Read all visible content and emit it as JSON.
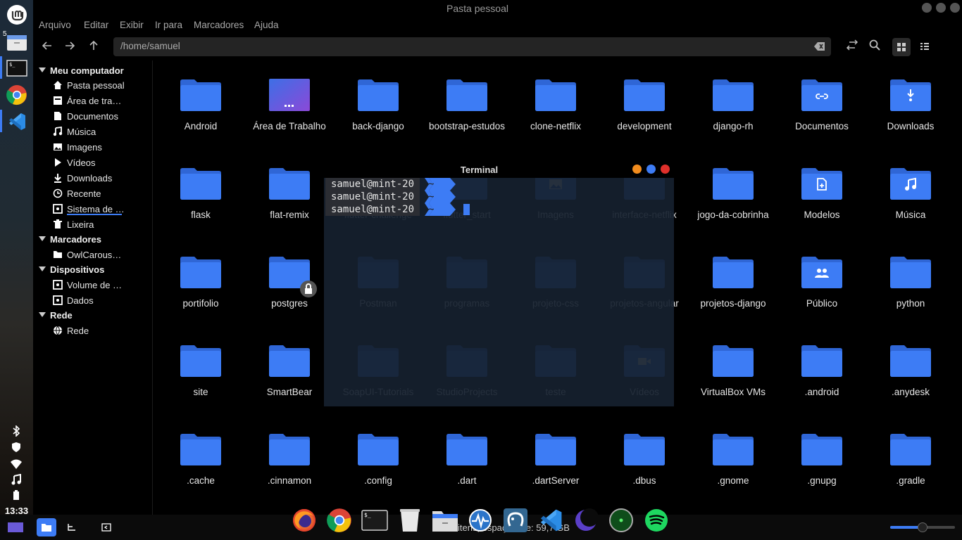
{
  "window": {
    "title": "Pasta pessoal"
  },
  "menu": [
    "Arquivo",
    "Editar",
    "Exibir",
    "Ir para",
    "Marcadores",
    "Ajuda"
  ],
  "location": {
    "path": "/home/samuel"
  },
  "sidebar": {
    "sections": [
      {
        "title": "Meu computador",
        "items": [
          {
            "label": "Pasta pessoal",
            "icon": "home-icon"
          },
          {
            "label": "Área de tra…",
            "icon": "desktop-icon"
          },
          {
            "label": "Documentos",
            "icon": "document-icon"
          },
          {
            "label": "Música",
            "icon": "music-icon"
          },
          {
            "label": "Imagens",
            "icon": "image-icon"
          },
          {
            "label": "Vídeos",
            "icon": "video-icon"
          },
          {
            "label": "Downloads",
            "icon": "download-icon"
          },
          {
            "label": "Recente",
            "icon": "clock-icon"
          },
          {
            "label": "Sistema de …",
            "icon": "drive-icon"
          },
          {
            "label": "Lixeira",
            "icon": "trash-icon"
          }
        ]
      },
      {
        "title": "Marcadores",
        "items": [
          {
            "label": "OwlCarous…",
            "icon": "folder-icon"
          }
        ]
      },
      {
        "title": "Dispositivos",
        "items": [
          {
            "label": "Volume de …",
            "icon": "drive-icon"
          },
          {
            "label": "Dados",
            "icon": "drive-icon"
          }
        ]
      },
      {
        "title": "Rede",
        "items": [
          {
            "label": "Rede",
            "icon": "network-icon"
          }
        ]
      }
    ]
  },
  "files": [
    {
      "name": "Android",
      "emblem": ""
    },
    {
      "name": "Área de Trabalho",
      "emblem": "desktop"
    },
    {
      "name": "back-django",
      "emblem": ""
    },
    {
      "name": "bootstrap-estudos",
      "emblem": ""
    },
    {
      "name": "clone-netflix",
      "emblem": ""
    },
    {
      "name": "development",
      "emblem": ""
    },
    {
      "name": "django-rh",
      "emblem": ""
    },
    {
      "name": "Documentos",
      "emblem": "link"
    },
    {
      "name": "Downloads",
      "emblem": "download"
    },
    {
      "name": "flask",
      "emblem": ""
    },
    {
      "name": "flat-remix",
      "emblem": ""
    },
    {
      "name": "flutter-challenge",
      "emblem": ""
    },
    {
      "name": "flutter_start",
      "emblem": ""
    },
    {
      "name": "Imagens",
      "emblem": "image"
    },
    {
      "name": "interface-netflix",
      "emblem": ""
    },
    {
      "name": "jogo-da-cobrinha",
      "emblem": ""
    },
    {
      "name": "Modelos",
      "emblem": "template"
    },
    {
      "name": "Música",
      "emblem": "music"
    },
    {
      "name": "portifolio",
      "emblem": ""
    },
    {
      "name": "postgres",
      "emblem": "lock"
    },
    {
      "name": "Postman",
      "emblem": ""
    },
    {
      "name": "programas",
      "emblem": ""
    },
    {
      "name": "projeto-css",
      "emblem": ""
    },
    {
      "name": "projetos-angular",
      "emblem": ""
    },
    {
      "name": "projetos-django",
      "emblem": ""
    },
    {
      "name": "Público",
      "emblem": "people"
    },
    {
      "name": "python",
      "emblem": ""
    },
    {
      "name": "site",
      "emblem": ""
    },
    {
      "name": "SmartBear",
      "emblem": ""
    },
    {
      "name": "SoapUI-Tutorials",
      "emblem": ""
    },
    {
      "name": "StudioProjects",
      "emblem": ""
    },
    {
      "name": "teste",
      "emblem": ""
    },
    {
      "name": "Vídeos",
      "emblem": "video"
    },
    {
      "name": "VirtualBox VMs",
      "emblem": ""
    },
    {
      "name": ".android",
      "emblem": ""
    },
    {
      "name": ".anydesk",
      "emblem": ""
    },
    {
      "name": ".cache",
      "emblem": ""
    },
    {
      "name": ".cinnamon",
      "emblem": ""
    },
    {
      "name": ".config",
      "emblem": ""
    },
    {
      "name": ".dart",
      "emblem": ""
    },
    {
      "name": ".dartServer",
      "emblem": ""
    },
    {
      "name": ".dbus",
      "emblem": ""
    },
    {
      "name": ".gnome",
      "emblem": ""
    },
    {
      "name": ".gnupg",
      "emblem": ""
    },
    {
      "name": ".gradle",
      "emblem": ""
    }
  ],
  "terminal": {
    "title": "Terminal",
    "lines": [
      {
        "user": "samuel@mint-20",
        "path": "~"
      },
      {
        "user": "samuel@mint-20",
        "path": "~"
      },
      {
        "user": "samuel@mint-20",
        "path": "~"
      }
    ]
  },
  "statusbar": {
    "text": "itens, espaço livre: 59,7 GB"
  },
  "clock": "13:33",
  "workspace_badge": "5",
  "zoom_level": 0.5,
  "colors": {
    "folder": "#3d7cf5",
    "folder_dark": "#2f66d6",
    "accent": "#3d7cf5"
  }
}
